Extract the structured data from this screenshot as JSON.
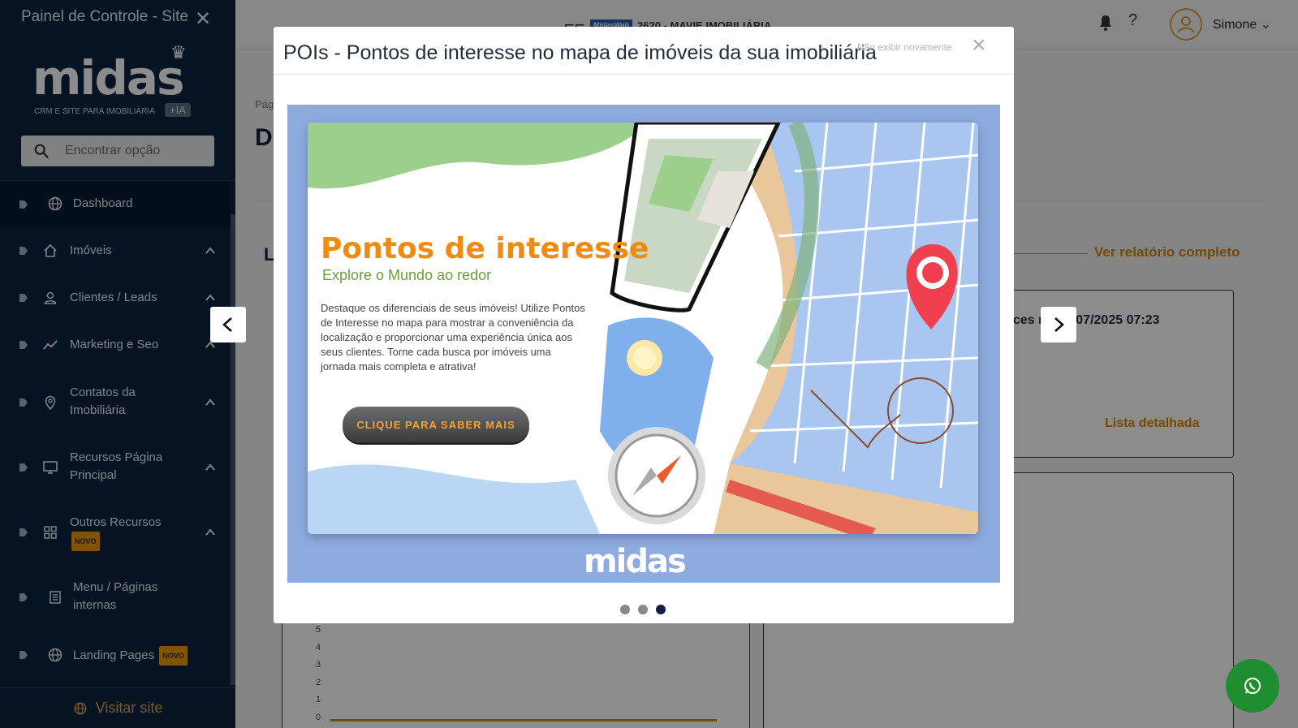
{
  "sidebar": {
    "title": "Painel de Controle - Site",
    "logo": {
      "word": "midas",
      "tagline": "CRM E SITE PARA IMOBILIÁRIA",
      "badge": "+IA"
    },
    "search_placeholder": "Encontrar opção",
    "items": [
      {
        "label": "Dashboard",
        "icon": "globe-icon"
      },
      {
        "label": "Imóveis",
        "icon": "home-icon"
      },
      {
        "label": "Clientes / Leads",
        "icon": "user-icon"
      },
      {
        "label": "Marketing e Seo",
        "icon": "trend-icon"
      },
      {
        "label": "Contatos da Imobiliária",
        "icon": "map-pin-icon"
      },
      {
        "label": "Recursos Página Principal",
        "icon": "monitor-icon"
      },
      {
        "label": "Outros Recursos",
        "icon": "grid-icon",
        "badge": "NOVO"
      },
      {
        "label": "Menu / Páginas internas",
        "icon": "document-icon"
      },
      {
        "label": "Landing Pages",
        "icon": "globe-icon",
        "badge": "NOVO"
      }
    ],
    "visit_label": "Visitar site"
  },
  "header": {
    "brand_badge": "MidasWeb",
    "brand_text": "2620 - MAVIE IMOBILIÁRIA",
    "help": "?",
    "user_name": "Simone"
  },
  "background": {
    "crumb": "Pág",
    "heading_initial": "D",
    "section_initial": "L",
    "ver_relatorio": "Ver relatório completo",
    "acesso": "aces    m: 15/07/2025 07:23",
    "lista": "Lista detalhada",
    "y_ticks": [
      "5",
      "4",
      "3",
      "2",
      "1",
      "0"
    ]
  },
  "modal": {
    "title": "POIs - Pontos de interesse no mapa de imóveis da sua imobiliária",
    "dont_show": "Não exibir novamente",
    "close": "×",
    "banner": {
      "title": "Pontos de interesse",
      "subtitle": "Explore o Mundo ao redor",
      "text": "Destaque os diferenciais de seus imóveis! Utilize Pontos de Interesse no mapa para mostrar a conveniência da localização e proporcionar uma experiência única aos seus clientes. Torne cada busca por imóveis uma jornada mais completa e atrativa!",
      "cta": "CLIQUE PARA SABER MAIS",
      "logo": "midas"
    },
    "active_slide": 3,
    "slide_count": 3
  },
  "colors": {
    "sidebar": "#0b2340",
    "accent": "#d4860e",
    "whatsapp": "#1f8e31"
  }
}
